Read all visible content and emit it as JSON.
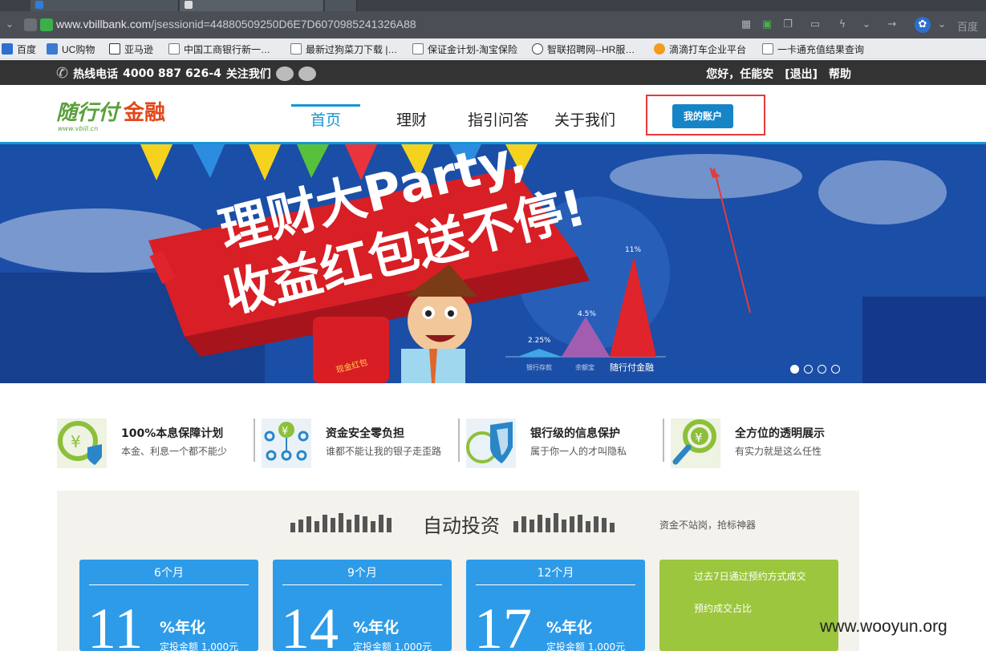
{
  "browser": {
    "url_domain": "www.vbillbank.com",
    "url_path": "/jsessionid=44880509250D6E7D6070985241326A88",
    "search_label": "百度"
  },
  "bookmarks": [
    {
      "label": "百度",
      "icon": "paw-icon"
    },
    {
      "label": "UC购物",
      "icon": "cursor-icon"
    },
    {
      "label": "亚马逊",
      "icon": "amazon-icon"
    },
    {
      "label": "中国工商银行新一…",
      "icon": "page-icon"
    },
    {
      "label": "最新过狗菜刀下载 |…",
      "icon": "page-icon"
    },
    {
      "label": "保证金计划-淘宝保险",
      "icon": "page-icon"
    },
    {
      "label": "智联招聘网--HR服…",
      "icon": "globe-icon"
    },
    {
      "label": "滴滴打车企业平台",
      "icon": "didi-icon"
    },
    {
      "label": "一卡通充值结果查询",
      "icon": "page-icon"
    }
  ],
  "topbar": {
    "hotline": "热线电话",
    "phone": "4000 887 626-4",
    "follow": "关注我们",
    "greeting": "您好，任能安",
    "logout": "[退出]",
    "help": "帮助"
  },
  "header": {
    "logo_main": "随行付",
    "logo_sub": "金融",
    "logo_url": "www.vbill.cn",
    "nav": [
      "首页",
      "理财",
      "指引问答",
      "关于我们"
    ],
    "account_button": "我的账户"
  },
  "banner": {
    "headline_1": "理财大Party,",
    "headline_2": "收益红包送不停!",
    "envelope_label": "现金红包",
    "chart_values": [
      "2.25%",
      "4.5%",
      "11%"
    ],
    "chart_labels": [
      "银行存款",
      "余额宝",
      "随行付金融"
    ]
  },
  "features": [
    {
      "title": "100%本息保障计划",
      "desc": "本金、利息一个都不能少",
      "icon": "yen-shield-icon",
      "color": "#8dbf3a"
    },
    {
      "title": "资金安全零负担",
      "desc": "谁都不能让我的银子走歪路",
      "icon": "yen-network-icon",
      "color": "#2a86c8"
    },
    {
      "title": "银行级的信息保护",
      "desc": "属于你一人的才叫隐私",
      "icon": "shield-globe-icon",
      "color": "#2a86c8"
    },
    {
      "title": "全方位的透明展示",
      "desc": "有实力就是这么任性",
      "icon": "yen-magnifier-icon",
      "color": "#8dbf3a"
    }
  ],
  "auto_invest": {
    "title": "自动投资",
    "subtitle": "资金不站岗，抢标神器",
    "cards": [
      {
        "period": "6个月",
        "rate": "11",
        "unit": "%年化",
        "amount": "定投金额 1,000元"
      },
      {
        "period": "9个月",
        "rate": "14",
        "unit": "%年化",
        "amount": "定投金额 1,000元"
      },
      {
        "period": "12个月",
        "rate": "17",
        "unit": "%年化",
        "amount": "定投金额 1,000元"
      }
    ],
    "stats_line1": "过去7日通过预约方式成交",
    "stats_line2": "预约成交占比"
  },
  "watermark": "www.wooyun.org"
}
